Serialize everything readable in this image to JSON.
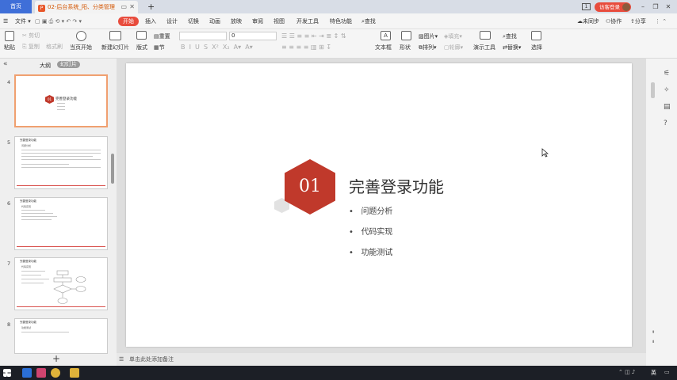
{
  "titlebar": {
    "home_tab": "首页",
    "doc_tab": "02-后台系统_阳、分类管理",
    "new_tab": "+",
    "badge": "1",
    "login": "访客登录",
    "minimize": "–",
    "restore": "❐",
    "close": "✕"
  },
  "menubar": {
    "file": "文件",
    "items": [
      "开始",
      "插入",
      "设计",
      "切换",
      "动画",
      "放映",
      "审阅",
      "视图",
      "开发工具",
      "特色功能"
    ],
    "search": "查找",
    "sync": "未同步",
    "collab": "协作",
    "share": "分享"
  },
  "toolbar": {
    "paste": "粘贴",
    "cut": "剪切",
    "copy": "复制",
    "format_painter": "格式刷",
    "play_current": "当页开始",
    "new_slide": "新建幻灯片",
    "layout": "版式",
    "reset": "重置",
    "section": "节",
    "font_size": "0",
    "text_box": "文本框",
    "shape": "形状",
    "arrange": "排列",
    "picture": "图片",
    "fill": "填充",
    "outline": "轮廓",
    "presentation_tools": "演示工具",
    "find": "查找",
    "replace": "替换",
    "select": "选择"
  },
  "panel": {
    "outline_tab": "大纲",
    "slides_tab": "幻灯片",
    "collapse_icon": "«",
    "add_slide": "+"
  },
  "slides": [
    {
      "num": "4",
      "badge": "01",
      "title": "完善登录功能"
    },
    {
      "num": "5",
      "title": "完善登录功能",
      "sub": "问题分析"
    },
    {
      "num": "6",
      "title": "完善登录功能",
      "sub": "代码实现"
    },
    {
      "num": "7",
      "title": "完善登录功能",
      "sub": "代码实现"
    },
    {
      "num": "8",
      "title": "完善登录功能",
      "sub": "功能测试"
    }
  ],
  "main_slide": {
    "number": "01",
    "title": "完善登录功能",
    "bullets": [
      "问题分析",
      "代码实现",
      "功能测试"
    ]
  },
  "notes": {
    "placeholder": "单击此处添加备注"
  },
  "taskbar": {
    "lang": "英"
  },
  "colors": {
    "accent": "#e84c3d",
    "hex_red": "#c0392b",
    "home_blue": "#3f6fd8"
  }
}
